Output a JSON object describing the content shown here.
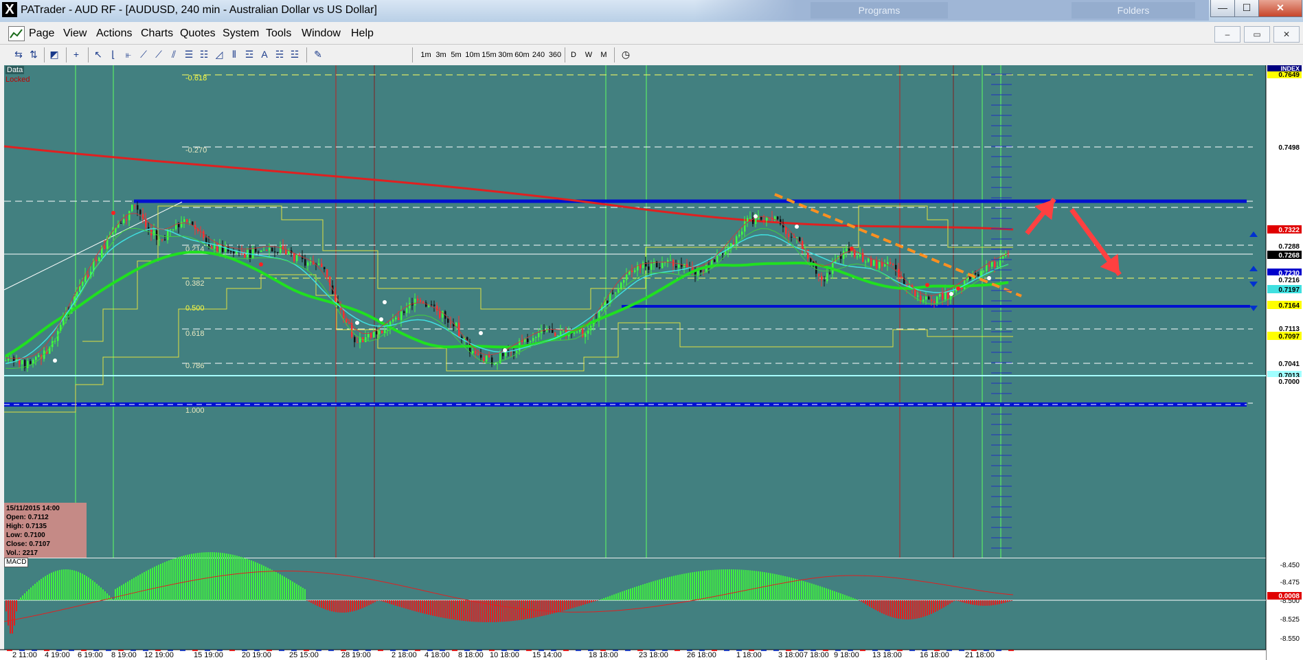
{
  "window": {
    "title": "PATrader - AUD RF - [AUDUSD, 240 min - Australian Dollar vs US Dollar]",
    "background_tabs": [
      "Programs",
      "Folders"
    ],
    "controls": {
      "minimize": "—",
      "maximize": "☐",
      "close": "✕"
    }
  },
  "menu": {
    "items": [
      "Page",
      "View",
      "Actions",
      "Charts",
      "Quotes",
      "System",
      "Tools",
      "Window",
      "Help"
    ],
    "mdi_controls": {
      "minimize": "–",
      "restore": "▭",
      "close": "✕"
    }
  },
  "toolbar": {
    "timeframes": [
      "1m",
      "3m",
      "5m",
      "10m",
      "15m",
      "30m",
      "60m",
      "240",
      "360",
      "D",
      "W",
      "M"
    ]
  },
  "chart": {
    "data_label": "Data",
    "locked_label": "Locked",
    "index_label": "INDEX",
    "info_box": {
      "date": "15/11/2015 14:00",
      "open": "Open: 0.7112",
      "high": "High: 0.7135",
      "low": "Low: 0.7100",
      "close": "Close: 0.7107",
      "volume": "Vol.: 2217"
    },
    "fib_levels": [
      "-0.618",
      "-0.270",
      "0.214",
      "0.382",
      "0.500",
      "0.618",
      "0.786",
      "1.000"
    ],
    "price_tags": [
      {
        "label": "0.7649",
        "bg": "#ffff00",
        "fg": "#000000"
      },
      {
        "label": "0.7498",
        "bg": "#ffffff",
        "fg": "#000000"
      },
      {
        "label": "0.7322",
        "bg": "#e00000",
        "fg": "#ffffff"
      },
      {
        "label": "0.7288",
        "bg": "#ffffff",
        "fg": "#000000"
      },
      {
        "label": "0.7268",
        "bg": "#000000",
        "fg": "#ffffff"
      },
      {
        "label": "0.7230",
        "bg": "#0000cc",
        "fg": "#ffffff"
      },
      {
        "label": "0.7216",
        "bg": "#ffffff",
        "fg": "#000000"
      },
      {
        "label": "0.7197",
        "bg": "#40e0e0",
        "fg": "#000000"
      },
      {
        "label": "0.7164",
        "bg": "#ffff00",
        "fg": "#000000"
      },
      {
        "label": "0.7113",
        "bg": "#ffffff",
        "fg": "#000000"
      },
      {
        "label": "0.7097",
        "bg": "#ffff00",
        "fg": "#000000"
      },
      {
        "label": "0.7041",
        "bg": "#ffffff",
        "fg": "#000000"
      },
      {
        "label": "0.7013",
        "bg": "#a0ffff",
        "fg": "#000000"
      },
      {
        "label": "0.7000",
        "bg": "#ffffff",
        "fg": "#000000"
      }
    ],
    "macd": {
      "label": "MACD",
      "axis_ticks": [
        "-8.450",
        "-8.475",
        "-8.500",
        "-8.525",
        "-8.550"
      ],
      "current_value": "0.0008"
    },
    "time_labels": [
      "2 11:00",
      "4 19:00",
      "6 19:00",
      "8 19:00",
      "12 19:00",
      "15 19:00",
      "20 19:00",
      "25 15:00",
      "28 19:00",
      "2 18:00",
      "4 18:00",
      "8 18:00",
      "10 18:00",
      "15 14:00",
      "18 18:00",
      "23 18:00",
      "26 18:00",
      "1 18:00",
      "3 18:00",
      "7 18:00",
      "9 18:00",
      "13 18:00",
      "16 18:00",
      "21 18:00"
    ]
  }
}
